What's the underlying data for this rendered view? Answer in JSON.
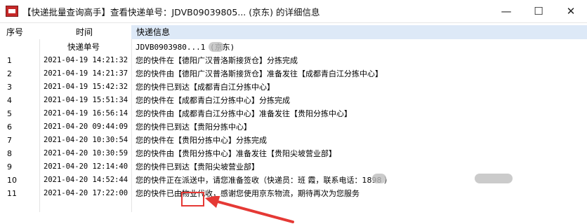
{
  "window": {
    "title": "【快递批量查询高手】查看快递单号：JDVB09039805... (京东) 的详细信息",
    "controls": {
      "minimize": "—",
      "maximize": "☐",
      "close": "✕"
    }
  },
  "table": {
    "headers": {
      "num": "序号",
      "time": "时间",
      "info": "快递信息"
    },
    "sub_header": {
      "time": "快递单号",
      "info": "JDVB0903980...1 (京东)"
    },
    "rows": [
      {
        "num": "1",
        "time": "2021-04-19 14:21:32",
        "info": "您的快件在【德阳广汉普洛斯接货仓】分拣完成"
      },
      {
        "num": "2",
        "time": "2021-04-19 14:21:37",
        "info": "您的快件由【德阳广汉普洛斯接货仓】准备发往【成都青白江分拣中心】"
      },
      {
        "num": "3",
        "time": "2021-04-19 15:42:32",
        "info": "您的快件已到达【成都青白江分拣中心】"
      },
      {
        "num": "4",
        "time": "2021-04-19 15:51:34",
        "info": "您的快件在【成都青白江分拣中心】分拣完成"
      },
      {
        "num": "5",
        "time": "2021-04-19 16:56:14",
        "info": "您的快件由【成都青白江分拣中心】准备发往【贵阳分拣中心】"
      },
      {
        "num": "6",
        "time": "2021-04-20 09:44:09",
        "info": "您的快件已到达【贵阳分拣中心】"
      },
      {
        "num": "7",
        "time": "2021-04-20 10:30:54",
        "info": "您的快件在【贵阳分拣中心】分拣完成"
      },
      {
        "num": "8",
        "time": "2021-04-20 10:30:59",
        "info": "您的快件由【贵阳分拣中心】准备发往【贵阳尖坡营业部】"
      },
      {
        "num": "9",
        "time": "2021-04-20 12:14:40",
        "info": "您的快件已到达【贵阳尖坡营业部】"
      },
      {
        "num": "10",
        "time": "2021-04-20 14:52:44",
        "info": "您的快件正在派送中，请您准备签收（快递员：班 霞，联系电话：1898 ）"
      },
      {
        "num": "11",
        "time": "2021-04-20 17:22:00",
        "info": "您的快件已由物业代收，感谢您使用京东物流，期待再次为您服务"
      }
    ]
  },
  "colors": {
    "header_info_bg": "#dde9f7",
    "annotation": "#e53935"
  }
}
